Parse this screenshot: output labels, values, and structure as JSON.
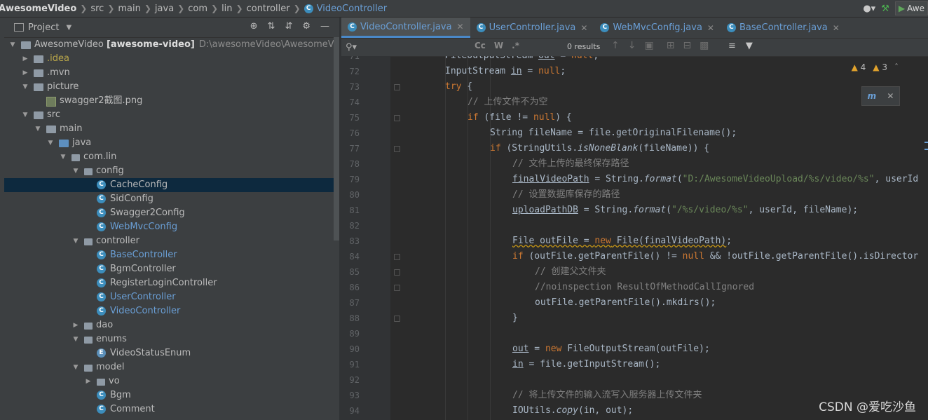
{
  "breadcrumb": {
    "items": [
      "AwesomeVideo",
      "src",
      "main",
      "java",
      "com",
      "lin",
      "controller"
    ],
    "active": "VideoController"
  },
  "topright": {
    "user_icon": "user-icon",
    "build_icon": "hammer-icon",
    "run_config": "Awe"
  },
  "project": {
    "title": "Project",
    "tools": [
      "crosshair-icon",
      "expand-icon",
      "collapse-icon",
      "gear-icon",
      "minimize-icon"
    ],
    "tree": [
      {
        "label": "AwesomeVideo",
        "module": "[awesome-video]",
        "path": "D:\\awesomeVideo\\AwesomeVideo",
        "depth": 0,
        "type": "module",
        "open": true
      },
      {
        "label": ".idea",
        "depth": 1,
        "type": "folder",
        "open": false,
        "color": "yellow"
      },
      {
        "label": ".mvn",
        "depth": 1,
        "type": "folder",
        "open": false
      },
      {
        "label": "picture",
        "depth": 1,
        "type": "folder",
        "open": true
      },
      {
        "label": "swagger2截图.png",
        "depth": 2,
        "type": "image"
      },
      {
        "label": "src",
        "depth": 1,
        "type": "folder",
        "open": true
      },
      {
        "label": "main",
        "depth": 2,
        "type": "folder",
        "open": true
      },
      {
        "label": "java",
        "depth": 3,
        "type": "srcfolder",
        "open": true
      },
      {
        "label": "com.lin",
        "depth": 4,
        "type": "package",
        "open": true
      },
      {
        "label": "config",
        "depth": 5,
        "type": "package",
        "open": true
      },
      {
        "label": "CacheConfig",
        "depth": 6,
        "type": "class",
        "selected": true
      },
      {
        "label": "SidConfig",
        "depth": 6,
        "type": "class"
      },
      {
        "label": "Swagger2Config",
        "depth": 6,
        "type": "class"
      },
      {
        "label": "WebMvcConfig",
        "depth": 6,
        "type": "class",
        "color": "blue"
      },
      {
        "label": "controller",
        "depth": 5,
        "type": "package",
        "open": true
      },
      {
        "label": "BaseController",
        "depth": 6,
        "type": "class",
        "color": "blue"
      },
      {
        "label": "BgmController",
        "depth": 6,
        "type": "class"
      },
      {
        "label": "RegisterLoginController",
        "depth": 6,
        "type": "class"
      },
      {
        "label": "UserController",
        "depth": 6,
        "type": "class",
        "color": "blue"
      },
      {
        "label": "VideoController",
        "depth": 6,
        "type": "class",
        "color": "blue"
      },
      {
        "label": "dao",
        "depth": 5,
        "type": "package",
        "open": false
      },
      {
        "label": "enums",
        "depth": 5,
        "type": "package",
        "open": true
      },
      {
        "label": "VideoStatusEnum",
        "depth": 6,
        "type": "enum"
      },
      {
        "label": "model",
        "depth": 5,
        "type": "package",
        "open": true
      },
      {
        "label": "vo",
        "depth": 6,
        "type": "package",
        "open": false
      },
      {
        "label": "Bgm",
        "depth": 6,
        "type": "class"
      },
      {
        "label": "Comment",
        "depth": 6,
        "type": "class"
      }
    ]
  },
  "tabs": [
    {
      "label": "VideoController.java",
      "active": true
    },
    {
      "label": "UserController.java",
      "color": "blue"
    },
    {
      "label": "WebMvcConfig.java",
      "color": "blue"
    },
    {
      "label": "BaseController.java",
      "color": "blue"
    }
  ],
  "find": {
    "placeholder": "",
    "match_case": "Cc",
    "words": "W",
    "regex": ".*",
    "results": "0 results"
  },
  "inspections": {
    "warnings": "4",
    "weak_warnings": "3"
  },
  "code_lines": [
    {
      "n": "71",
      "indent": 0,
      "parts": [
        [
          "t",
          "FileOutputStream "
        ],
        [
          "fd",
          "out"
        ],
        [
          "t",
          " = "
        ],
        [
          "kw",
          "null"
        ],
        [
          "t",
          ";"
        ]
      ]
    },
    {
      "n": "72",
      "indent": 0,
      "parts": [
        [
          "t",
          "InputStream "
        ],
        [
          "fd",
          "in"
        ],
        [
          "t",
          " = "
        ],
        [
          "kw",
          "null"
        ],
        [
          "t",
          ";"
        ]
      ]
    },
    {
      "n": "73",
      "indent": 0,
      "fold": true,
      "parts": [
        [
          "kw",
          "try"
        ],
        [
          "t",
          " {"
        ]
      ]
    },
    {
      "n": "74",
      "indent": 1,
      "parts": [
        [
          "cm",
          "// 上传文件不为空"
        ]
      ]
    },
    {
      "n": "75",
      "indent": 1,
      "fold": true,
      "parts": [
        [
          "kw",
          "if"
        ],
        [
          "t",
          " (file != "
        ],
        [
          "kw",
          "null"
        ],
        [
          "t",
          ") {"
        ]
      ]
    },
    {
      "n": "76",
      "indent": 2,
      "parts": [
        [
          "t",
          "String fileName = file.getOriginalFilename();"
        ]
      ]
    },
    {
      "n": "77",
      "indent": 2,
      "fold": true,
      "parts": [
        [
          "kw",
          "if"
        ],
        [
          "t",
          " (StringUtils."
        ],
        [
          "it",
          "isNoneBlank"
        ],
        [
          "t",
          "(fileName)) {"
        ]
      ]
    },
    {
      "n": "78",
      "indent": 3,
      "parts": [
        [
          "cm",
          "// 文件上传的最终保存路径"
        ]
      ]
    },
    {
      "n": "79",
      "indent": 3,
      "parts": [
        [
          "fd",
          "finalVideoPath"
        ],
        [
          "t",
          " = String."
        ],
        [
          "it",
          "format"
        ],
        [
          "t",
          "("
        ],
        [
          "st",
          "\"D:/AwesomeVideoUpload/%s/video/%s\""
        ],
        [
          "t",
          ", userId"
        ]
      ]
    },
    {
      "n": "80",
      "indent": 3,
      "parts": [
        [
          "cm",
          "// 设置数据库保存的路径"
        ]
      ]
    },
    {
      "n": "81",
      "indent": 3,
      "parts": [
        [
          "fd",
          "uploadPathDB"
        ],
        [
          "t",
          " = String."
        ],
        [
          "it",
          "format"
        ],
        [
          "t",
          "("
        ],
        [
          "st",
          "\"/%s/video/%s\""
        ],
        [
          "t",
          ", userId, fileName);"
        ]
      ]
    },
    {
      "n": "82",
      "indent": 0,
      "parts": []
    },
    {
      "n": "83",
      "indent": 3,
      "parts": [
        [
          "wv",
          "File outFile = "
        ],
        [
          "wk",
          "new"
        ],
        [
          "wv",
          " File(finalVideoPath)"
        ],
        [
          "t",
          ";"
        ]
      ]
    },
    {
      "n": "84",
      "indent": 3,
      "fold": true,
      "parts": [
        [
          "kw",
          "if"
        ],
        [
          "t",
          " (outFile.getParentFile() != "
        ],
        [
          "kw",
          "null"
        ],
        [
          "t",
          " && !outFile.getParentFile().isDirector"
        ]
      ]
    },
    {
      "n": "85",
      "indent": 4,
      "fold": true,
      "parts": [
        [
          "cm",
          "// 创建父文件夹"
        ]
      ]
    },
    {
      "n": "86",
      "indent": 4,
      "fold": true,
      "parts": [
        [
          "cm",
          "//noinspection ResultOfMethodCallIgnored"
        ]
      ]
    },
    {
      "n": "87",
      "indent": 4,
      "parts": [
        [
          "t",
          "outFile.getParentFile().mkdirs();"
        ]
      ]
    },
    {
      "n": "88",
      "indent": 3,
      "fold": true,
      "parts": [
        [
          "t",
          "}"
        ]
      ]
    },
    {
      "n": "89",
      "indent": 0,
      "parts": []
    },
    {
      "n": "90",
      "indent": 3,
      "parts": [
        [
          "fd",
          "out"
        ],
        [
          "t",
          " = "
        ],
        [
          "kw",
          "new"
        ],
        [
          "t",
          " FileOutputStream(outFile);"
        ]
      ]
    },
    {
      "n": "91",
      "indent": 3,
      "parts": [
        [
          "fd",
          "in"
        ],
        [
          "t",
          " = file.getInputStream();"
        ]
      ]
    },
    {
      "n": "92",
      "indent": 0,
      "parts": []
    },
    {
      "n": "93",
      "indent": 3,
      "parts": [
        [
          "cm",
          "// 将上传文件的输入流写入服务器上传文件夹"
        ]
      ]
    },
    {
      "n": "94",
      "indent": 3,
      "parts": [
        [
          "t",
          "IOUtils."
        ],
        [
          "it",
          "copy"
        ],
        [
          "t",
          "(in, out);"
        ]
      ]
    }
  ],
  "watermark": "CSDN @爱吃沙鱼"
}
